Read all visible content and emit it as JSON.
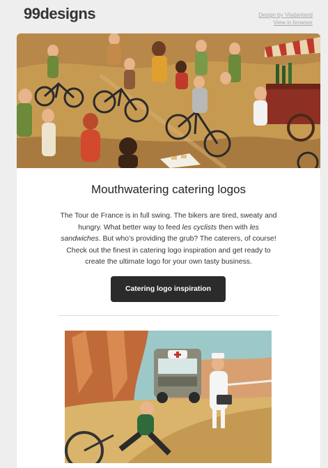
{
  "header": {
    "logo": "99designs",
    "design_credit": "Design by Vladanland",
    "view_in_browser": "View in browser"
  },
  "email": {
    "title": "Mouthwatering catering logos",
    "body": {
      "p1": "The Tour de France is in full swing. The bikers are tired, sweaty and hungry. What better way to feed ",
      "em1": "les cyclists",
      "p2": " then with ",
      "em2": "les sandwiches",
      "p3": ". But who’s providing the grub? The caterers, of course! Check out the finest in catering logo inspiration and get ready to create the ultimate logo for your own tasty business."
    },
    "cta_label": "Catering logo inspiration"
  },
  "colors": {
    "page_bg": "#eeeeee",
    "card_bg": "#ffffff",
    "button_bg": "#2b2b2b",
    "hero_ground": "#c79a52"
  }
}
